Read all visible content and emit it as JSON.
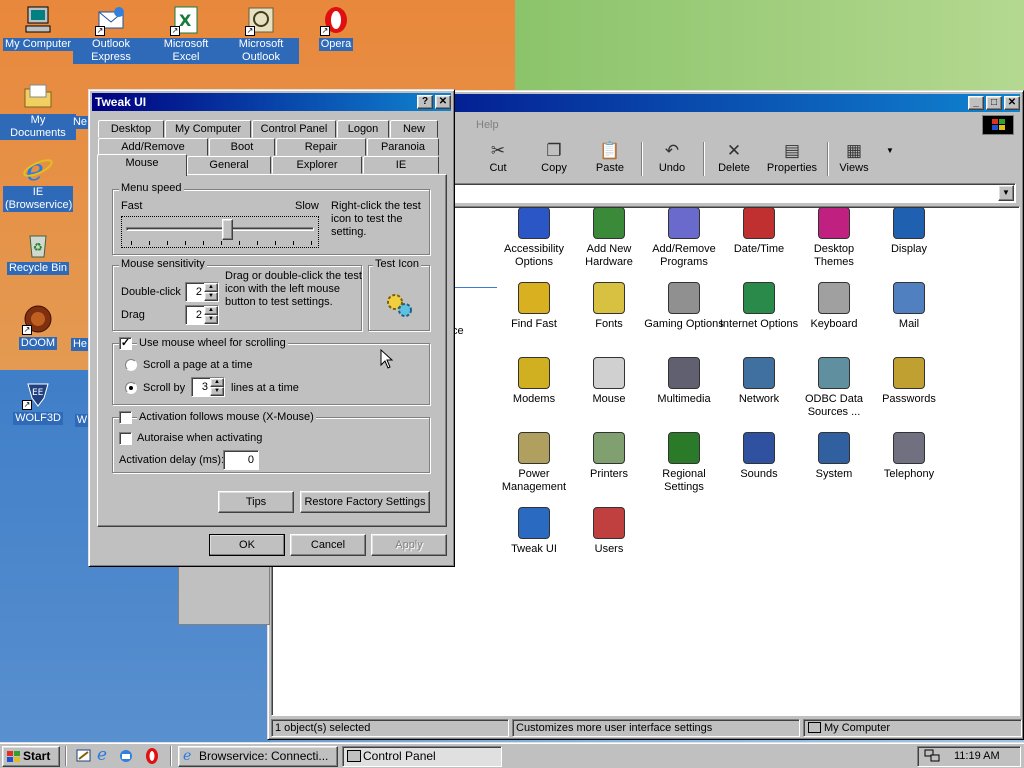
{
  "desktop_icons": [
    {
      "label": "My Computer",
      "icon": "computer-icon"
    },
    {
      "label": "Outlook Express",
      "icon": "outlook-express-icon"
    },
    {
      "label": "Microsoft Excel",
      "icon": "excel-icon"
    },
    {
      "label": "Microsoft Outlook",
      "icon": "outlook-icon"
    },
    {
      "label": "Opera",
      "icon": "opera-icon"
    },
    {
      "label": "My Documents",
      "icon": "folder-icon"
    },
    {
      "label": "IE (Browservice)",
      "icon": "ie-icon"
    },
    {
      "label": "Recycle Bin",
      "icon": "recycle-bin-icon"
    },
    {
      "label": "DOOM",
      "icon": "doom-icon"
    },
    {
      "label": "WOLF3D",
      "icon": "wolf3d-icon"
    },
    {
      "label": "Ne",
      "icon": "partial-icon"
    },
    {
      "label": "He",
      "icon": "partial-icon"
    },
    {
      "label": "W",
      "icon": "partial-icon"
    }
  ],
  "control_panel": {
    "menu_help": "Help",
    "toolbar": [
      {
        "label": "Cut",
        "icon": "scissors-icon",
        "glyph": "✂"
      },
      {
        "label": "Copy",
        "icon": "copy-icon",
        "glyph": "❐"
      },
      {
        "label": "Paste",
        "icon": "paste-icon",
        "glyph": "📋"
      },
      {
        "label": "Undo",
        "icon": "undo-icon",
        "glyph": "↶"
      },
      {
        "label": "Delete",
        "icon": "delete-icon",
        "glyph": "✕"
      },
      {
        "label": "Properties",
        "icon": "properties-icon",
        "glyph": "▤"
      },
      {
        "label": "Views",
        "icon": "views-icon",
        "glyph": "▦"
      }
    ],
    "left_pane_text": "ce",
    "items": [
      {
        "label": "Accessibility Options",
        "color": "#2a56c6"
      },
      {
        "label": "Add New Hardware",
        "color": "#3a8a3a"
      },
      {
        "label": "Add/Remove Programs",
        "color": "#6a6acc"
      },
      {
        "label": "Date/Time",
        "color": "#c03030"
      },
      {
        "label": "Desktop Themes",
        "color": "#c02080"
      },
      {
        "label": "Display",
        "color": "#2060b0"
      },
      {
        "label": "Find Fast",
        "color": "#d8b020"
      },
      {
        "label": "Fonts",
        "color": "#d8c040"
      },
      {
        "label": "Gaming Options",
        "color": "#909090"
      },
      {
        "label": "Internet Options",
        "color": "#2a8a4a"
      },
      {
        "label": "Keyboard",
        "color": "#a0a0a0"
      },
      {
        "label": "Mail",
        "color": "#5080c0"
      },
      {
        "label": "Modems",
        "color": "#d0b020"
      },
      {
        "label": "Mouse",
        "color": "#d0d0d0"
      },
      {
        "label": "Multimedia",
        "color": "#606070"
      },
      {
        "label": "Network",
        "color": "#4070a0"
      },
      {
        "label": "ODBC Data Sources ...",
        "color": "#6090a0"
      },
      {
        "label": "Passwords",
        "color": "#c0a030"
      },
      {
        "label": "Power Management",
        "color": "#b0a060"
      },
      {
        "label": "Printers",
        "color": "#80a070"
      },
      {
        "label": "Regional Settings",
        "color": "#2a7a2a"
      },
      {
        "label": "Sounds",
        "color": "#3050a0"
      },
      {
        "label": "System",
        "color": "#3060a0"
      },
      {
        "label": "Telephony",
        "color": "#707080"
      },
      {
        "label": "Tweak UI",
        "color": "#2a6ac0"
      },
      {
        "label": "Users",
        "color": "#c04040"
      }
    ],
    "status": {
      "selected": "1 object(s) selected",
      "description": "Customizes more user interface settings",
      "location": "My Computer"
    }
  },
  "tweak_ui": {
    "title": "Tweak UI",
    "tabs_row1": [
      "Desktop",
      "My Computer",
      "Control Panel",
      "Logon",
      "New"
    ],
    "tabs_row2": [
      "Add/Remove",
      "Boot",
      "Repair",
      "Paranoia"
    ],
    "tabs_row3": [
      "Mouse",
      "General",
      "Explorer",
      "IE"
    ],
    "menu_speed": {
      "title": "Menu speed",
      "fast": "Fast",
      "slow": "Slow",
      "hint": "Right-click the test icon to test the setting.",
      "level": 0.55
    },
    "mouse_sensitivity": {
      "title": "Mouse sensitivity",
      "double_click_label": "Double-click",
      "double_click_value": "2",
      "drag_label": "Drag",
      "drag_value": "2",
      "hint": "Drag or double-click the test icon with the left mouse button to test settings."
    },
    "test_icon": {
      "title": "Test Icon"
    },
    "wheel": {
      "label": "Use mouse wheel for scrolling",
      "checked": true,
      "page_label": "Scroll a page at a time",
      "scroll_by_label": "Scroll by",
      "scroll_by_value": "3",
      "lines_label": "lines at a time"
    },
    "xmouse": {
      "label": "Activation follows mouse (X-Mouse)",
      "autoraise_label": "Autoraise when activating",
      "delay_label": "Activation delay (ms):",
      "delay_value": "0"
    },
    "buttons": {
      "tips": "Tips",
      "restore": "Restore Factory Settings",
      "ok": "OK",
      "cancel": "Cancel",
      "apply": "Apply"
    }
  },
  "taskbar": {
    "start": "Start",
    "tasks": [
      {
        "label": "Browservice: Connecti..."
      },
      {
        "label": "Control Panel"
      }
    ],
    "clock": "11:19 AM"
  }
}
